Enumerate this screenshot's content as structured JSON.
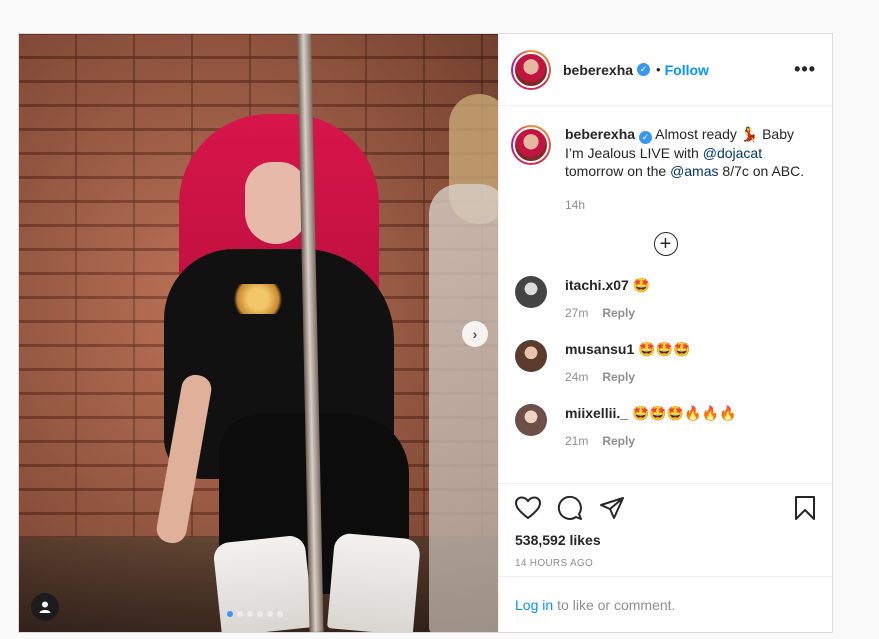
{
  "post": {
    "username": "beberexha",
    "follow_label": "Follow",
    "separator": "•",
    "more_label": "•••"
  },
  "caption": {
    "username": "beberexha",
    "text_1": "Almost ready 💃 Baby I’m Jealous LIVE with ",
    "mention_1": "@dojacat",
    "text_2": " tomorrow on the ",
    "mention_2": "@amas",
    "text_3": " 8/7c on ABC.",
    "time": "14h"
  },
  "comments": [
    {
      "username": "itachi.x07",
      "text": "🤩",
      "time": "27m",
      "reply": "Reply",
      "avatar_color": "#555555"
    },
    {
      "username": "musansu1",
      "text": "🤩🤩🤩",
      "time": "24m",
      "reply": "Reply",
      "avatar_color": "#8a6b55"
    },
    {
      "username": "miixellii._",
      "text": "🤩🤩🤩🔥🔥🔥",
      "time": "21m",
      "reply": "Reply",
      "avatar_color": "#a8867a"
    }
  ],
  "stats": {
    "likes": "538,592 likes",
    "posted": "14 HOURS AGO"
  },
  "footer": {
    "login_link": "Log in",
    "login_text": "to like or comment."
  },
  "carousel": {
    "next": "›",
    "total_slides": 6,
    "active_slide": 1
  }
}
